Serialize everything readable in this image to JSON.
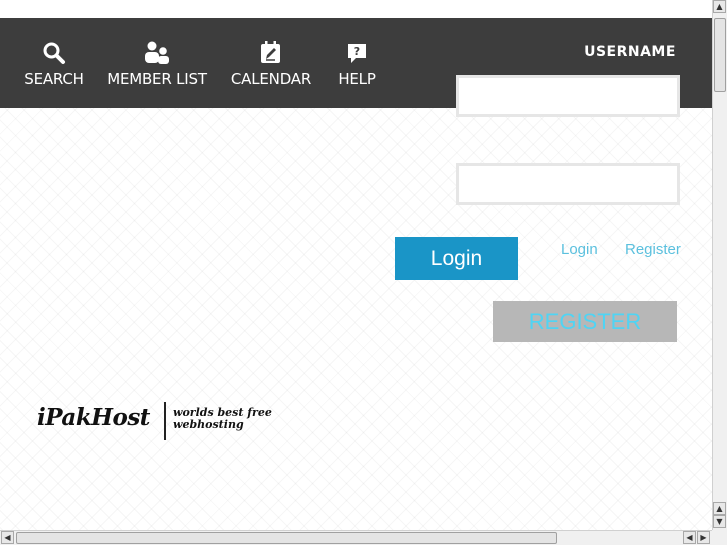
{
  "nav": {
    "search": {
      "label": "SEARCH",
      "icon": "search-icon"
    },
    "members": {
      "label": "MEMBER LIST",
      "icon": "users-icon"
    },
    "calendar": {
      "label": "CALENDAR",
      "icon": "calendar-icon"
    },
    "help": {
      "label": "HELP",
      "icon": "help-icon"
    }
  },
  "auth": {
    "username_heading": "USERNAME",
    "username_value": "",
    "password_value": "",
    "login_button": "Login",
    "login_link": "Login",
    "register_link": "Register",
    "register_button": "REGISTER"
  },
  "logo": {
    "name": "iPakHost",
    "tagline_line1": "worlds best free",
    "tagline_line2": "webhosting"
  },
  "colors": {
    "navbar_bg": "#3d3d3d",
    "login_button_bg": "#1a95c7",
    "link": "#5bc0de",
    "register_button_bg": "#b7b7b7",
    "register_button_text": "#4fd4f4"
  }
}
